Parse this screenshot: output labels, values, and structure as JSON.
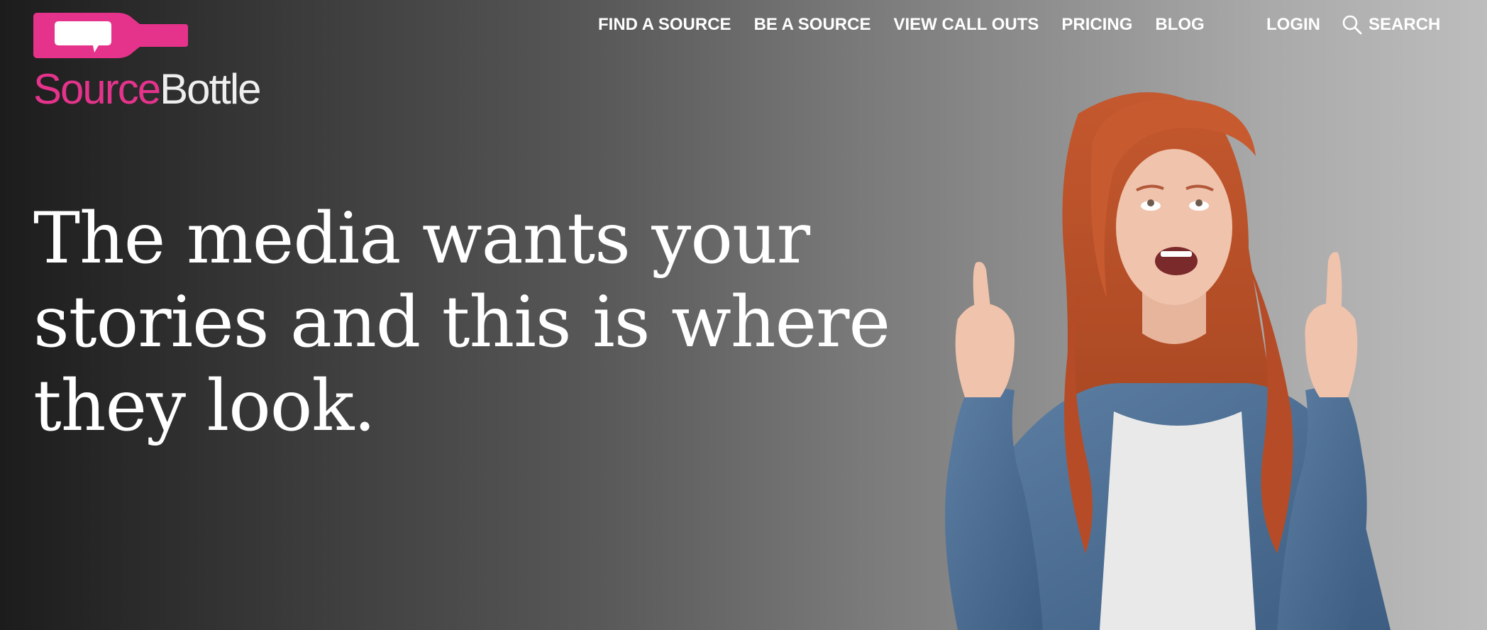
{
  "logo": {
    "source_text": "Source",
    "bottle_text": "Bottle",
    "colors": {
      "pink": "#e5338c",
      "white": "#ffffff"
    }
  },
  "nav": {
    "items": [
      {
        "label": "FIND A SOURCE"
      },
      {
        "label": "BE A SOURCE"
      },
      {
        "label": "VIEW CALL OUTS"
      },
      {
        "label": "PRICING"
      },
      {
        "label": "BLOG"
      }
    ],
    "login_label": "LOGIN",
    "search_label": "SEARCH",
    "search_icon": "search-icon"
  },
  "hero": {
    "headline_lines": [
      "The media wants your",
      "stories and this is where",
      "they look."
    ]
  }
}
